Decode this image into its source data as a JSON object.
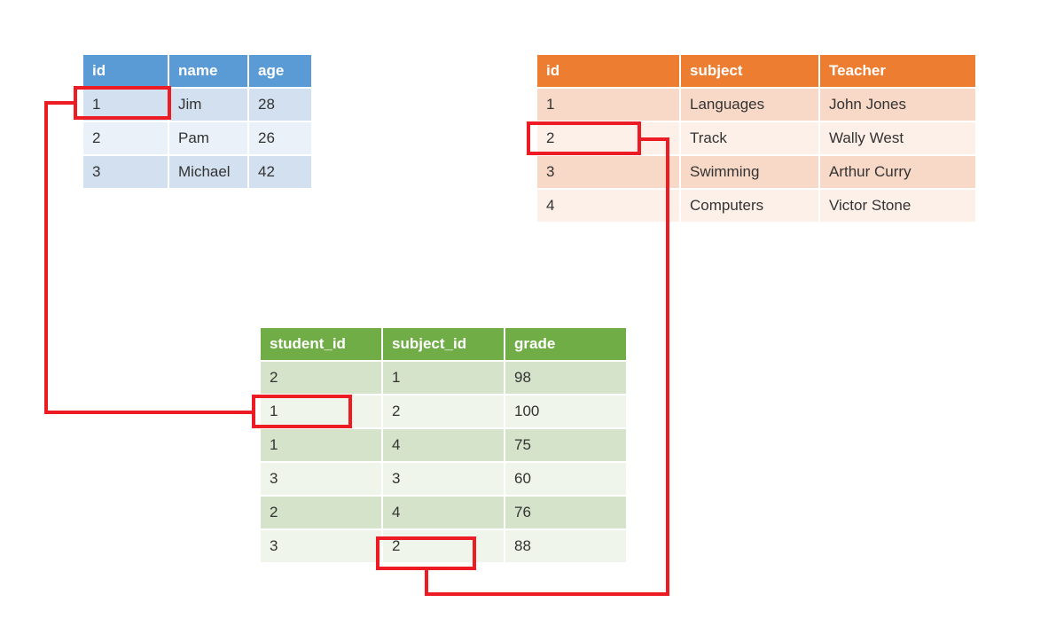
{
  "students": {
    "headers": [
      "id",
      "name",
      "age"
    ],
    "rows": [
      {
        "id": "1",
        "name": "Jim",
        "age": "28"
      },
      {
        "id": "2",
        "name": "Pam",
        "age": "26"
      },
      {
        "id": "3",
        "name": "Michael",
        "age": "42"
      }
    ]
  },
  "subjects": {
    "headers": [
      "id",
      "subject",
      "Teacher"
    ],
    "rows": [
      {
        "id": "1",
        "subject": "Languages",
        "teacher": "John Jones"
      },
      {
        "id": "2",
        "subject": "Track",
        "teacher": "Wally West"
      },
      {
        "id": "3",
        "subject": "Swimming",
        "teacher": "Arthur Curry"
      },
      {
        "id": "4",
        "subject": "Computers",
        "teacher": "Victor Stone"
      }
    ]
  },
  "grades": {
    "headers": [
      "student_id",
      "subject_id",
      "grade"
    ],
    "rows": [
      {
        "student_id": "2",
        "subject_id": "1",
        "grade": "98"
      },
      {
        "student_id": "1",
        "subject_id": "2",
        "grade": "100"
      },
      {
        "student_id": "1",
        "subject_id": "4",
        "grade": "75"
      },
      {
        "student_id": "3",
        "subject_id": "3",
        "grade": "60"
      },
      {
        "student_id": "2",
        "subject_id": "4",
        "grade": "76"
      },
      {
        "student_id": "3",
        "subject_id": "2",
        "grade": "88"
      }
    ]
  }
}
